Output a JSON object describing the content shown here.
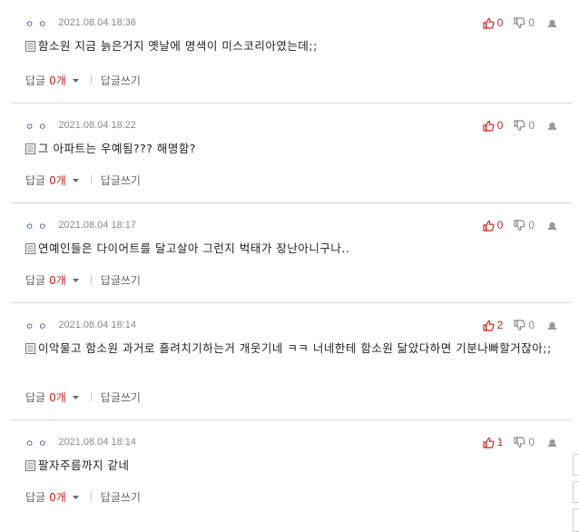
{
  "labels": {
    "reply": "답글",
    "count_suffix": "개",
    "write_reply": "답글쓰기"
  },
  "comments": [
    {
      "nickname": "ㅇㅇ",
      "date": "2021.08.04 18:36",
      "up": "0",
      "down": "0",
      "text": "함소원 지금 늙은거지 옛날에 명색이 미스코리아였는데;;",
      "reply_count": "0"
    },
    {
      "nickname": "ㅇㅇ",
      "date": "2021.08.04 18:22",
      "up": "0",
      "down": "0",
      "text": "그 아파트는 우예됨??? 해명함?",
      "reply_count": "0"
    },
    {
      "nickname": "ㅇㅇ",
      "date": "2021.08.04 18:17",
      "up": "0",
      "down": "0",
      "text": "연예인들은 다이어트를 달고살아 그런지 벅태가 장난아니구나..",
      "reply_count": "0"
    },
    {
      "nickname": "ㅇㅇ",
      "date": "2021.08.04 18:14",
      "up": "2",
      "down": "0",
      "text": "이악물고 함소원 과거로 흘려치기하는거 개웃기네 ㅋㅋ 너네한테 함소원 닮았다하면 기분나빠할거잖아;;",
      "reply_count": "0"
    },
    {
      "nickname": "ㅇㅇ",
      "date": "2021.08.04 18:14",
      "up": "1",
      "down": "0",
      "text": "팔자주름까지 같네",
      "reply_count": "0"
    }
  ],
  "icons": {
    "upvote": "thumbs-up-icon",
    "downvote": "thumbs-down-icon",
    "report": "report-icon",
    "memo": "memo-icon",
    "dropdown": "chevron-down-icon"
  },
  "colors": {
    "accent_red": "#d0211b",
    "muted": "#8a8a8a",
    "divider": "#d9d9d9"
  }
}
